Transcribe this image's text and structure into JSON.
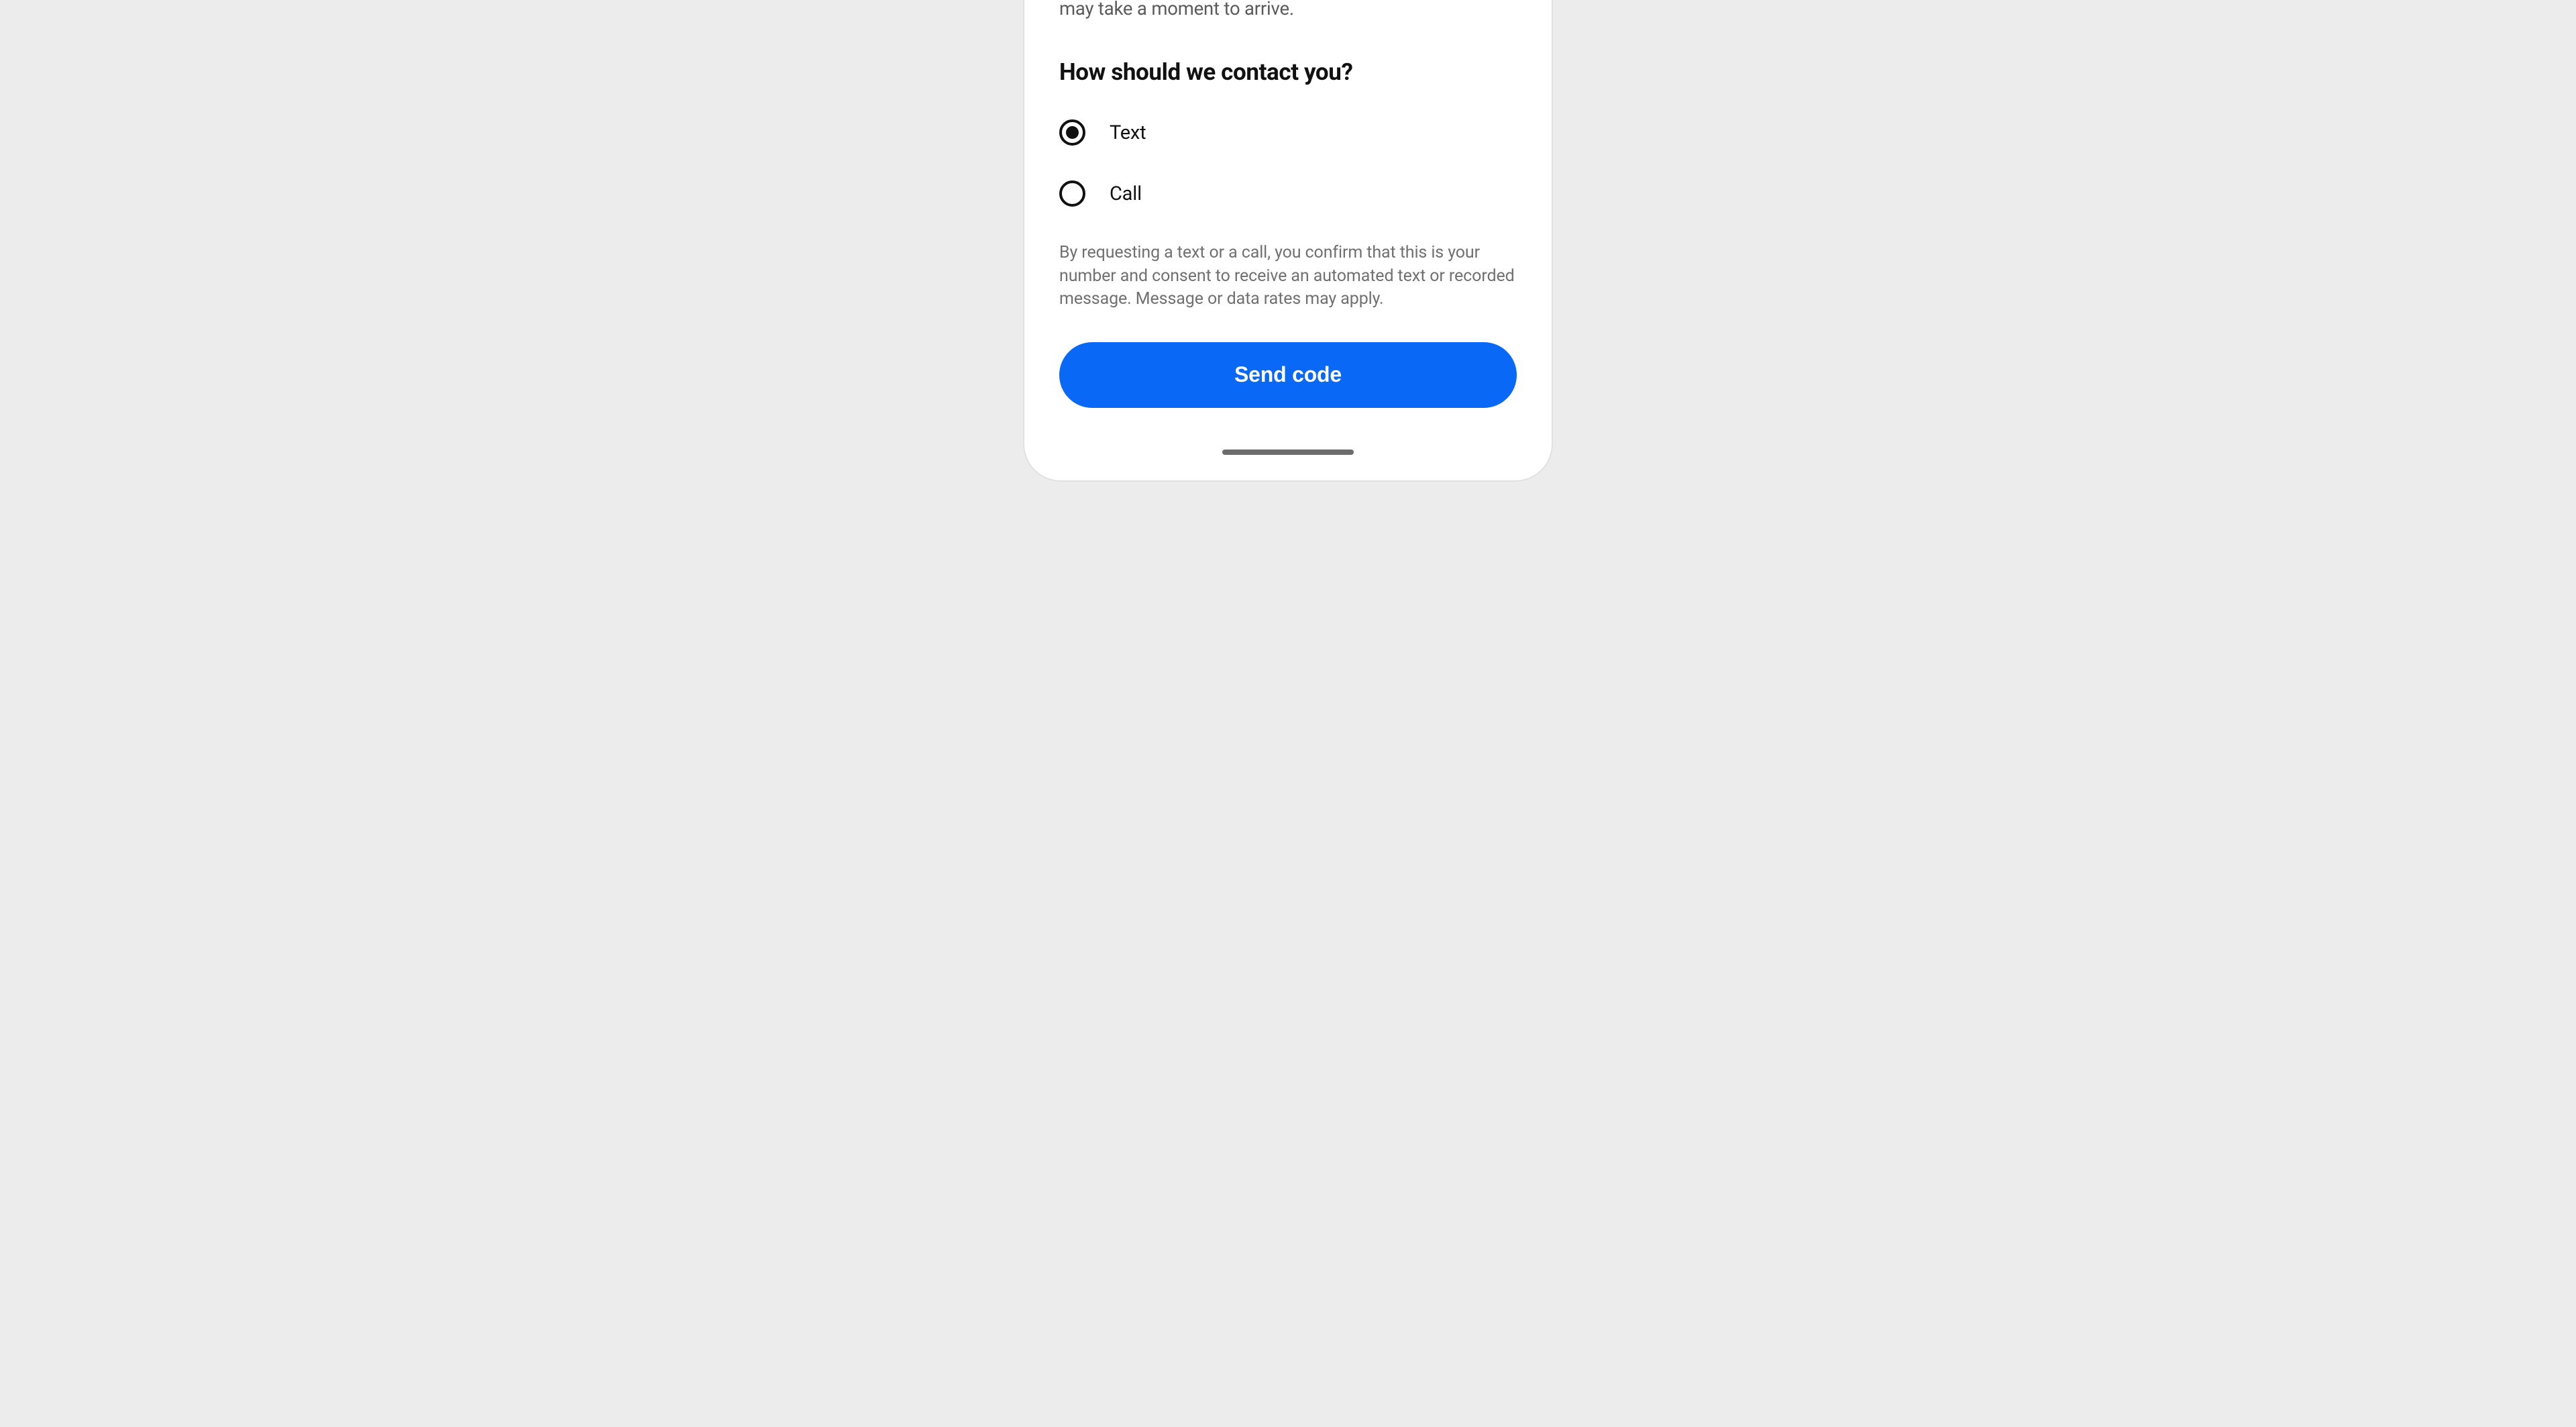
{
  "partial_top_text": "may take a moment to arrive.",
  "heading": "How should we contact you?",
  "options": {
    "text": {
      "label": "Text",
      "selected": true
    },
    "call": {
      "label": "Call",
      "selected": false
    }
  },
  "disclaimer": "By requesting a text or a call, you confirm that this is your number and consent to receive an automated text or recorded message. Message or data rates may apply.",
  "button_label": "Send code",
  "colors": {
    "primary": "#0968f6"
  }
}
